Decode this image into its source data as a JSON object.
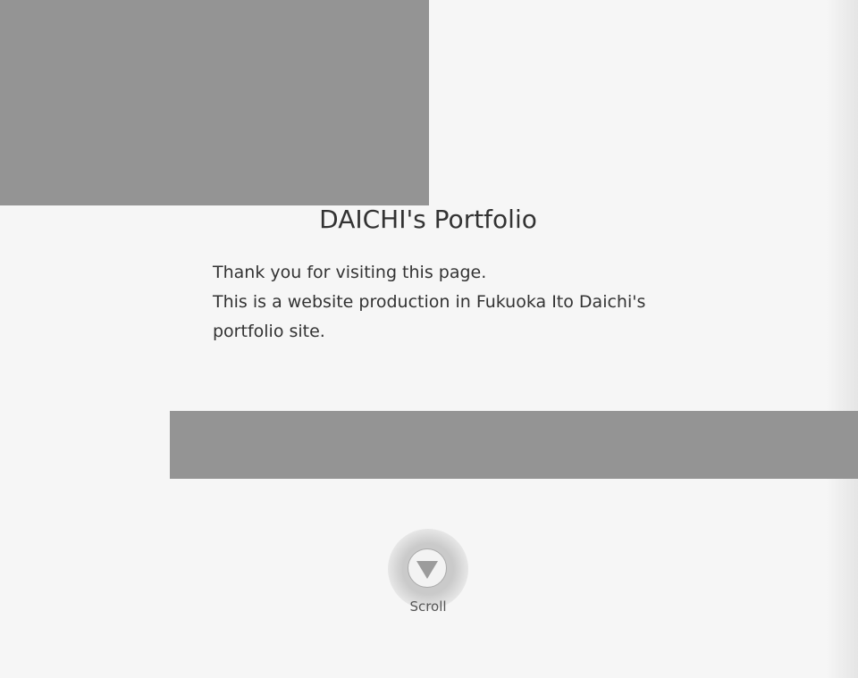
{
  "hero": {
    "title": "DAICHI's Portfolio",
    "intro_lines": [
      "Thank you for visiting this page.",
      "This is a website production in Fukuoka Ito Daichi's",
      "portfolio site."
    ]
  },
  "scroll": {
    "label": "Scroll",
    "icon": "triangle-down-icon"
  },
  "colors": {
    "background": "#f6f6f6",
    "placeholder_block": "#949494",
    "text": "#333333"
  }
}
